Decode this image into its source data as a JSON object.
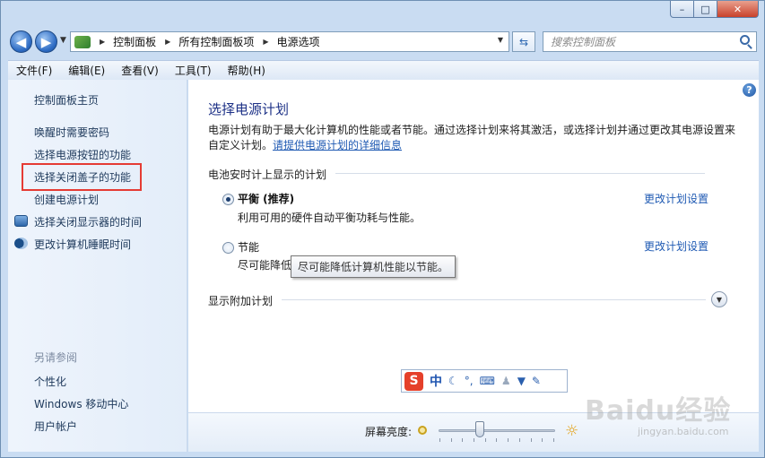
{
  "window": {
    "minimize_glyph": "–",
    "maximize_glyph": "□",
    "close_glyph": "✕"
  },
  "nav": {
    "back_glyph": "◀",
    "forward_glyph": "▶"
  },
  "address": {
    "crumbs": [
      "控制面板",
      "所有控制面板项",
      "电源选项"
    ]
  },
  "search": {
    "placeholder": "搜索控制面板"
  },
  "menu": {
    "items": [
      "文件(F)",
      "编辑(E)",
      "查看(V)",
      "工具(T)",
      "帮助(H)"
    ]
  },
  "sidebar": {
    "home": "控制面板主页",
    "links": [
      "唤醒时需要密码",
      "选择电源按钮的功能",
      "选择关闭盖子的功能",
      "创建电源计划",
      "选择关闭显示器的时间",
      "更改计算机睡眠时间"
    ],
    "see_also_title": "另请参阅",
    "see_also": [
      "个性化",
      "Windows 移动中心",
      "用户帐户"
    ]
  },
  "main": {
    "title": "选择电源计划",
    "description": "电源计划有助于最大化计算机的性能或者节能。通过选择计划来将其激活，或选择计划并通过更改其电源设置来自定义计划。",
    "description_link": "请提供电源计划的详细信息",
    "section_battery": "电池安时计上显示的计划",
    "plans": [
      {
        "name": "平衡 (推荐)",
        "desc": "利用可用的硬件自动平衡功耗与性能。",
        "selected": true,
        "link": "更改计划设置"
      },
      {
        "name": "节能",
        "desc": "尽可能降低",
        "selected": false,
        "link": "更改计划设置"
      }
    ],
    "tooltip": "尽可能降低计算机性能以节能。",
    "section_more": "显示附加计划"
  },
  "ime": {
    "logo": "S",
    "mode": "中",
    "icons": [
      "moon-icon",
      "punctuation-icon",
      "keyboard-icon",
      "user-icon",
      "shirt-icon",
      "wrench-icon"
    ]
  },
  "bottom": {
    "brightness_label": "屏幕亮度:",
    "brightness_percent": 35
  },
  "watermark": {
    "text": "Baidu经验",
    "sub": "jingyan.baidu.com"
  },
  "colors": {
    "link": "#1f5ab3",
    "title": "#1e3287",
    "highlight": "#e53b34"
  }
}
